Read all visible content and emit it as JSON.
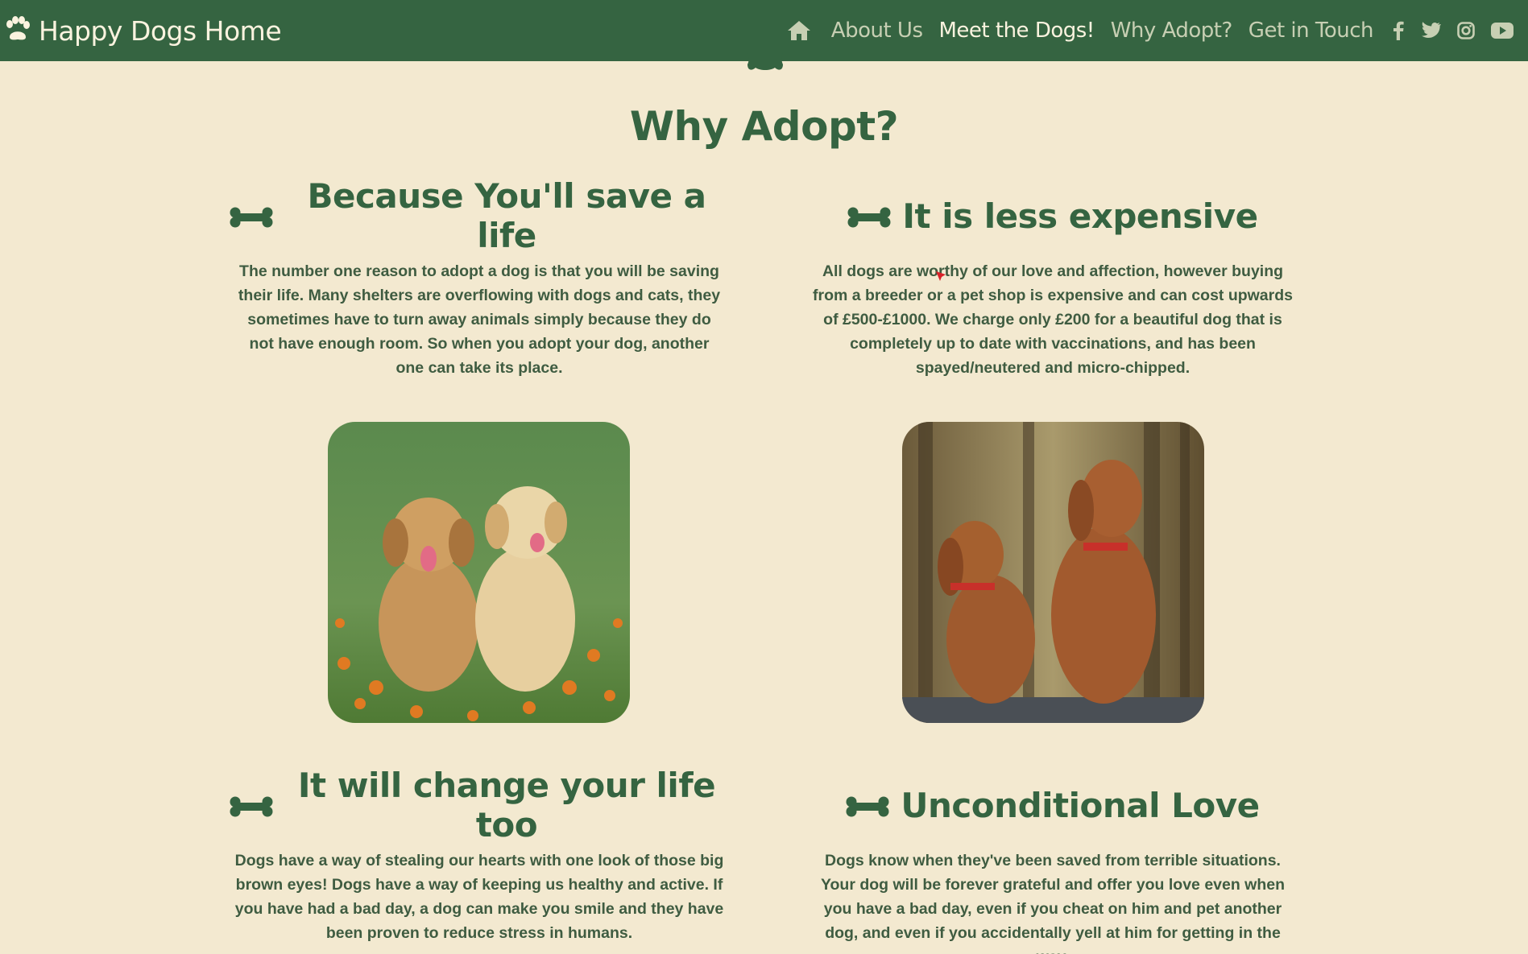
{
  "brand": {
    "name": "Happy Dogs Home",
    "icon": "paw-icon"
  },
  "nav": {
    "home_icon": "home-icon",
    "links": [
      {
        "label": "About Us",
        "active": false
      },
      {
        "label": "Meet the Dogs!",
        "active": true
      },
      {
        "label": "Why Adopt?",
        "active": false
      },
      {
        "label": "Get in Touch",
        "active": false
      }
    ],
    "social": [
      "facebook-icon",
      "twitter-icon",
      "instagram-icon",
      "youtube-icon"
    ]
  },
  "page": {
    "title": "Why Adopt?"
  },
  "reasons": [
    {
      "heading": "Because You'll save a life",
      "text": "The number one reason to adopt a dog is that you will be saving their life. Many shelters are overflowing with dogs and cats, they sometimes have to turn away animals simply because they do not have enough room. So when you adopt your dog, another one can take its place."
    },
    {
      "heading": "It is less expensive",
      "text": "All dogs are worthy of our love and affection, however buying from a breeder or a pet shop is expensive and can cost upwards of £500-£1000. We charge only £200 for a beautiful dog that is completely up to date with vaccinations, and has been spayed/neutered and micro-chipped."
    },
    {
      "heading": "It will change your life too",
      "text": "Dogs have a way of stealing our hearts with one look of those big brown eyes! Dogs have a way of keeping us healthy and active. If you have had a bad day, a dog can make you smile and they have been proven to reduce stress in humans."
    },
    {
      "heading": "Unconditional Love",
      "text": "Dogs know when they've been saved from terrible situations. Your dog will be forever grateful and offer you love even when you have a bad day, even if you cheat on him and pet another dog, and even if you accidentally yell at him for getting in the way."
    }
  ],
  "colors": {
    "nav_bg": "#356441",
    "page_bg": "#f3e9d0",
    "accent": "#356441",
    "text": "#3f5c41"
  }
}
